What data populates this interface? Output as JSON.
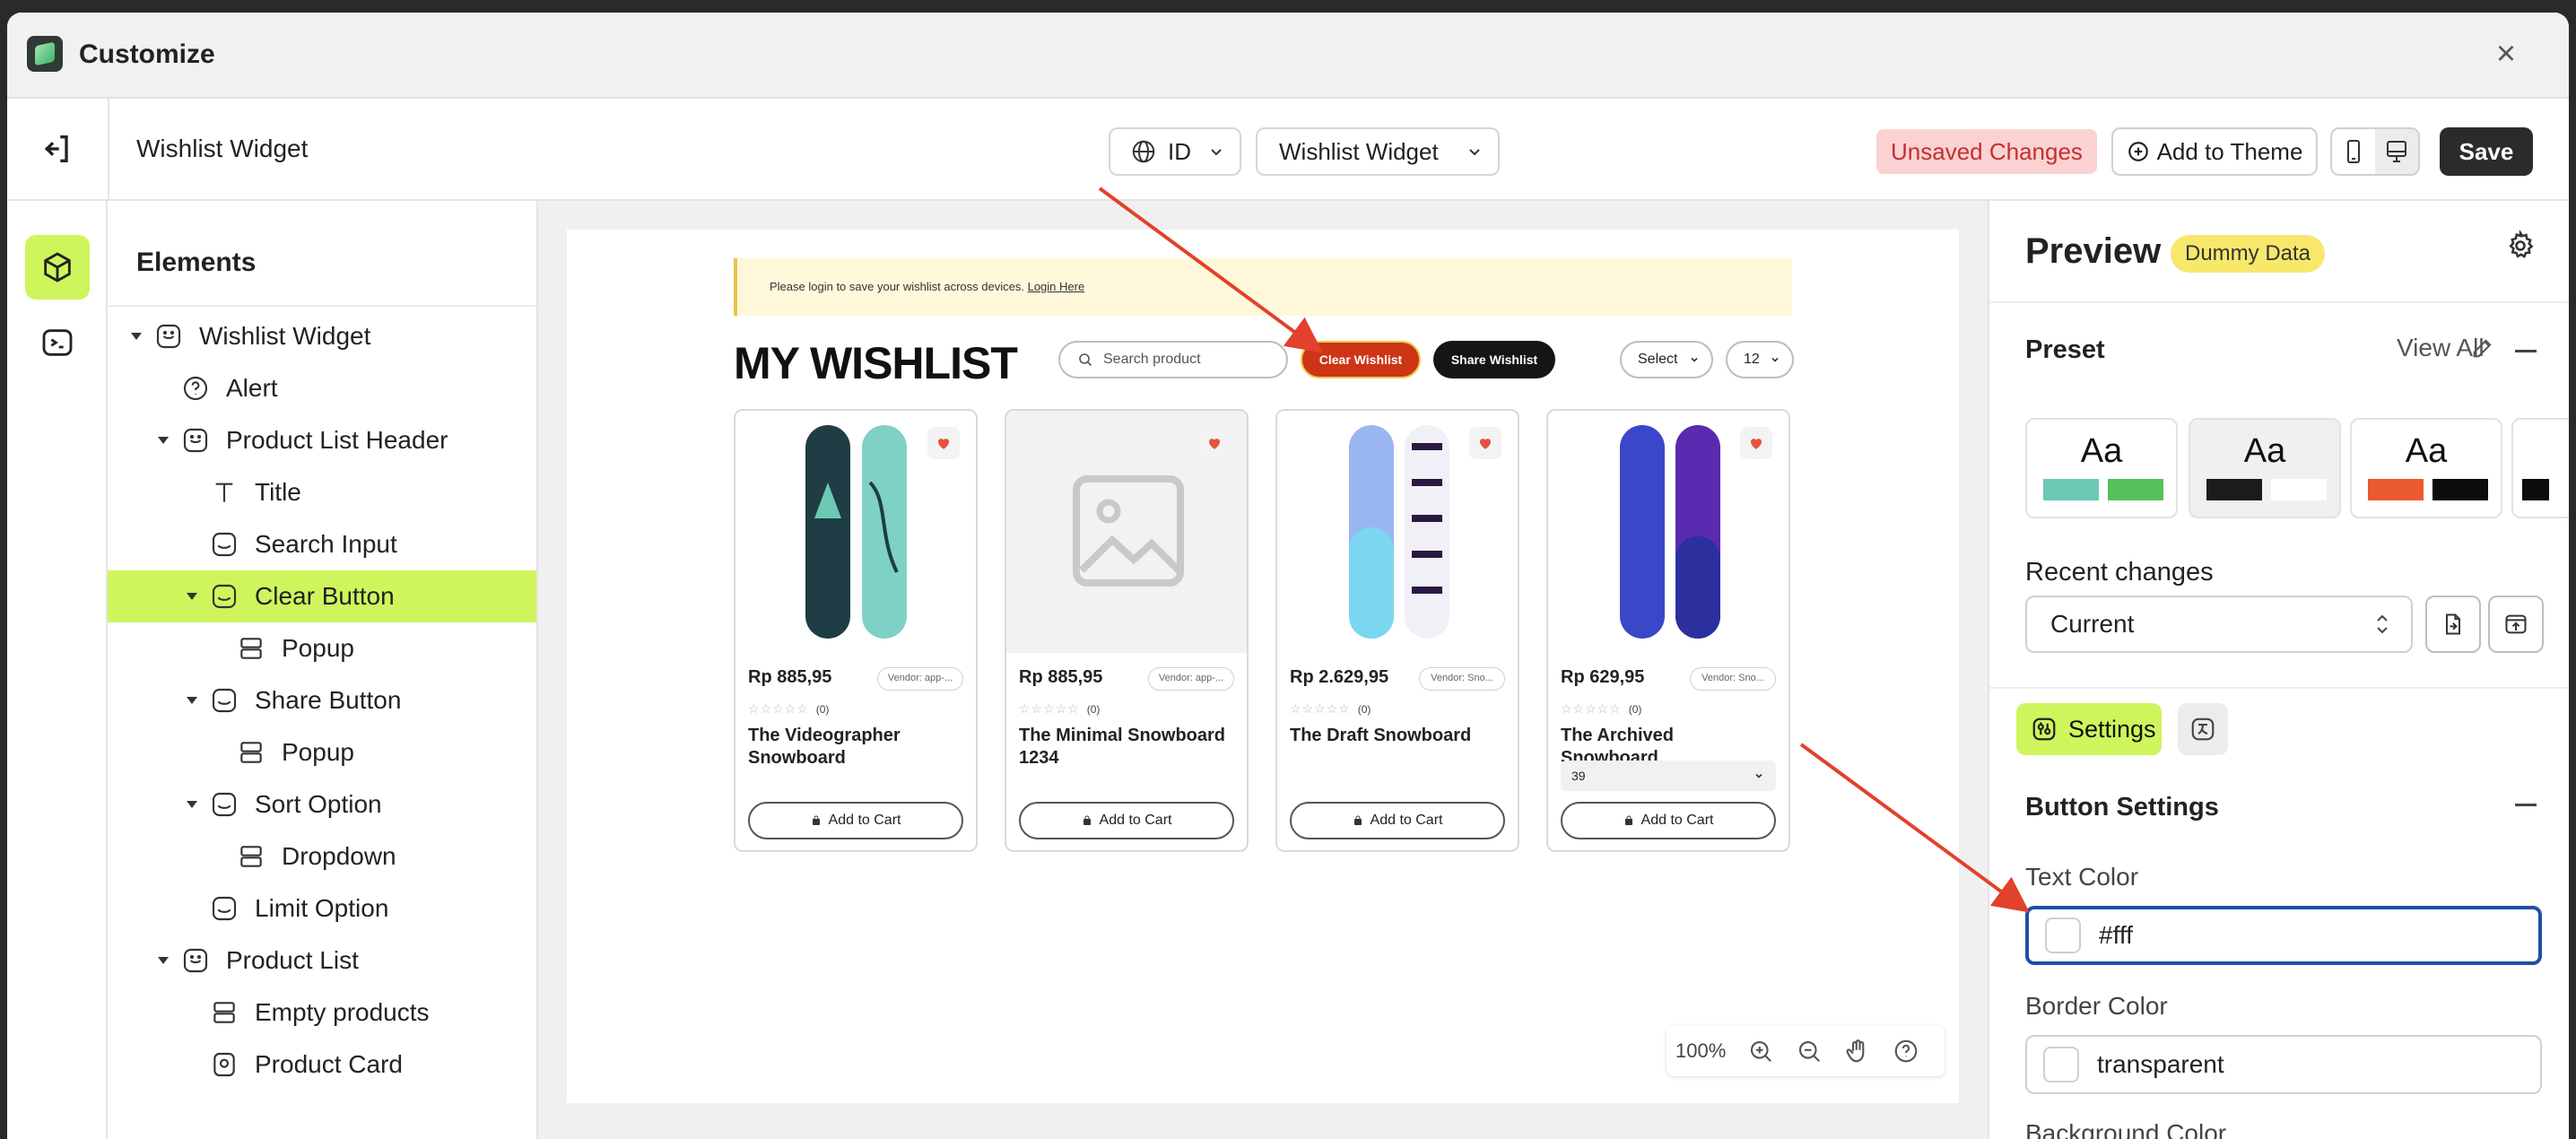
{
  "window": {
    "title": "Customize"
  },
  "toolbar": {
    "page_name": "Wishlist Widget",
    "language": "ID",
    "widget_select": "Wishlist Widget",
    "unsaved": "Unsaved Changes",
    "add_to_theme": "Add to Theme",
    "save": "Save"
  },
  "tree": {
    "title": "Elements",
    "items": [
      {
        "label": "Wishlist Widget"
      },
      {
        "label": "Alert"
      },
      {
        "label": "Product List Header"
      },
      {
        "label": "Title"
      },
      {
        "label": "Search Input"
      },
      {
        "label": "Clear Button"
      },
      {
        "label": "Popup"
      },
      {
        "label": "Share Button"
      },
      {
        "label": "Popup"
      },
      {
        "label": "Sort Option"
      },
      {
        "label": "Dropdown"
      },
      {
        "label": "Limit Option"
      },
      {
        "label": "Product List"
      },
      {
        "label": "Empty products"
      },
      {
        "label": "Product Card"
      }
    ]
  },
  "canvas": {
    "alert_text": "Please login to save your wishlist across devices.",
    "alert_link": "Login Here",
    "title": "MY WISHLIST",
    "search_placeholder": "Search product",
    "clear_label": "Clear Wishlist",
    "share_label": "Share Wishlist",
    "sort_label": "Select",
    "limit_label": "12",
    "stars": "☆☆☆☆☆",
    "add_to_cart": "Add to Cart",
    "products": [
      {
        "price": "Rp 885,95",
        "vendor": "Vendor: app-...",
        "reviews": "(0)",
        "name": "The Videographer Snowboard"
      },
      {
        "price": "Rp 885,95",
        "vendor": "Vendor: app-...",
        "reviews": "(0)",
        "name": "The Minimal Snowboard 1234"
      },
      {
        "price": "Rp 2.629,95",
        "vendor": "Vendor: Sno...",
        "reviews": "(0)",
        "name": "The Draft Snowboard"
      },
      {
        "price": "Rp 629,95",
        "vendor": "Vendor: Sno...",
        "reviews": "(0)",
        "name": "The Archived Snowboard",
        "variant": "39"
      }
    ],
    "zoom": "100%"
  },
  "panel": {
    "preview_title": "Preview",
    "dummy_badge": "Dummy Data",
    "preset_label": "Preset",
    "view_all": "View All",
    "preset_text": "Aa",
    "presets": [
      {
        "colors": [
          "#6cc9b4",
          "#56c15a"
        ]
      },
      {
        "colors": [
          "#1c1c1c",
          "#ffffff"
        ]
      },
      {
        "colors": [
          "#ec5a2f",
          "#0c0c0c"
        ]
      }
    ],
    "recent_label": "Recent changes",
    "recent_value": "Current",
    "settings_tab": "Settings",
    "button_settings": "Button Settings",
    "text_color_label": "Text Color",
    "text_color_value": "#fff",
    "border_color_label": "Border Color",
    "border_color_value": "transparent",
    "background_color_label": "Background Color"
  },
  "colors": {
    "accent": "#cff55d",
    "clear_button": "#cc3516",
    "unsaved_bg": "#fbd2d2",
    "focus_border": "#1f4fa3",
    "arrow": "#e2412b"
  }
}
